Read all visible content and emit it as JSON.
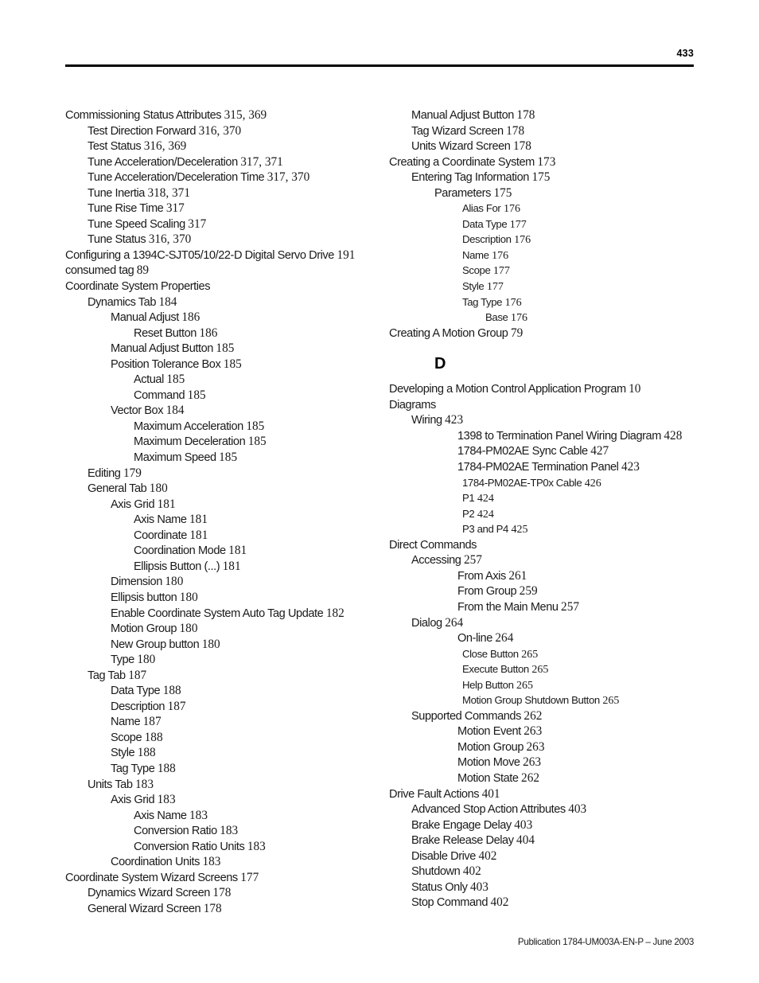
{
  "header": {
    "page_number": "433"
  },
  "footer": {
    "publication": "Publication 1784-UM003A-EN-P – June 2003"
  },
  "columns": {
    "left": [
      {
        "level": 0,
        "text": "Commissioning Status Attributes",
        "pages": "315, 369"
      },
      {
        "level": 1,
        "text": "Test Direction Forward",
        "pages": "316, 370"
      },
      {
        "level": 1,
        "text": "Test Status",
        "pages": "316, 369"
      },
      {
        "level": 1,
        "text": "Tune Acceleration/Deceleration",
        "pages": "317, 371"
      },
      {
        "level": 1,
        "text": "Tune Acceleration/Deceleration Time",
        "pages": "317, 370"
      },
      {
        "level": 1,
        "text": "Tune Inertia",
        "pages": "318, 371"
      },
      {
        "level": 1,
        "text": "Tune Rise Time",
        "pages": "317"
      },
      {
        "level": 1,
        "text": "Tune Speed Scaling",
        "pages": "317"
      },
      {
        "level": 1,
        "text": "Tune Status",
        "pages": "316, 370"
      },
      {
        "level": 0,
        "text": "Configuring a 1394C-SJT05/10/22-D Digital Servo Drive",
        "pages": "191"
      },
      {
        "level": 0,
        "text": "consumed tag",
        "pages": "89"
      },
      {
        "level": 0,
        "text": "Coordinate System Properties",
        "pages": ""
      },
      {
        "level": 1,
        "text": "Dynamics Tab",
        "pages": "184"
      },
      {
        "level": 2,
        "text": "Manual Adjust",
        "pages": "186"
      },
      {
        "level": 3,
        "text": "Reset Button",
        "pages": "186"
      },
      {
        "level": 2,
        "text": "Manual Adjust Button",
        "pages": "185"
      },
      {
        "level": 2,
        "text": "Position Tolerance Box",
        "pages": "185"
      },
      {
        "level": 3,
        "text": "Actual",
        "pages": "185"
      },
      {
        "level": 3,
        "text": "Command",
        "pages": "185"
      },
      {
        "level": 2,
        "text": "Vector Box",
        "pages": "184"
      },
      {
        "level": 3,
        "text": "Maximum Acceleration",
        "pages": "185"
      },
      {
        "level": 3,
        "text": "Maximum Deceleration",
        "pages": "185"
      },
      {
        "level": 3,
        "text": "Maximum Speed",
        "pages": "185"
      },
      {
        "level": 1,
        "text": "Editing",
        "pages": "179"
      },
      {
        "level": 1,
        "text": "General Tab",
        "pages": "180"
      },
      {
        "level": 2,
        "text": "Axis Grid",
        "pages": "181"
      },
      {
        "level": 3,
        "text": "Axis Name",
        "pages": "181"
      },
      {
        "level": 3,
        "text": "Coordinate",
        "pages": "181"
      },
      {
        "level": 3,
        "text": "Coordination Mode",
        "pages": "181"
      },
      {
        "level": 3,
        "text": "Ellipsis Button (...)",
        "pages": "181"
      },
      {
        "level": 2,
        "text": "Dimension",
        "pages": "180"
      },
      {
        "level": 2,
        "text": "Ellipsis button",
        "pages": "180"
      },
      {
        "level": 2,
        "text": "Enable Coordinate System Auto Tag Update",
        "pages": "182"
      },
      {
        "level": 2,
        "text": "Motion Group",
        "pages": "180"
      },
      {
        "level": 2,
        "text": "New Group button",
        "pages": "180"
      },
      {
        "level": 2,
        "text": "Type",
        "pages": "180"
      },
      {
        "level": 1,
        "text": "Tag Tab",
        "pages": "187"
      },
      {
        "level": 2,
        "text": "Data Type",
        "pages": "188"
      },
      {
        "level": 2,
        "text": "Description",
        "pages": "187"
      },
      {
        "level": 2,
        "text": "Name",
        "pages": "187"
      },
      {
        "level": 2,
        "text": "Scope",
        "pages": "188"
      },
      {
        "level": 2,
        "text": "Style",
        "pages": "188"
      },
      {
        "level": 2,
        "text": "Tag Type",
        "pages": "188"
      },
      {
        "level": 1,
        "text": "Units Tab",
        "pages": "183"
      },
      {
        "level": 2,
        "text": "Axis Grid",
        "pages": "183"
      },
      {
        "level": 3,
        "text": "Axis Name",
        "pages": "183"
      },
      {
        "level": 3,
        "text": "Conversion Ratio",
        "pages": "183"
      },
      {
        "level": 3,
        "text": "Conversion Ratio Units",
        "pages": "183"
      },
      {
        "level": 2,
        "text": "Coordination Units",
        "pages": "183"
      },
      {
        "level": 0,
        "text": "Coordinate System Wizard Screens",
        "pages": "177"
      },
      {
        "level": 1,
        "text": "Dynamics Wizard Screen",
        "pages": "178"
      },
      {
        "level": 1,
        "text": "General Wizard Screen",
        "pages": "178"
      }
    ],
    "right_before_section": [
      {
        "level": 1,
        "text": "Manual Adjust Button",
        "pages": "178"
      },
      {
        "level": 1,
        "text": "Tag Wizard Screen",
        "pages": "178"
      },
      {
        "level": 1,
        "text": "Units Wizard Screen",
        "pages": "178"
      },
      {
        "level": 0,
        "text": "Creating a Coordinate System",
        "pages": "173"
      },
      {
        "level": 1,
        "text": "Entering Tag Information",
        "pages": "175"
      },
      {
        "level": 2,
        "text": "Parameters",
        "pages": "175"
      },
      {
        "level": 4,
        "text": "Alias For",
        "pages": "176"
      },
      {
        "level": 4,
        "text": "Data Type",
        "pages": "177"
      },
      {
        "level": 4,
        "text": "Description",
        "pages": "176"
      },
      {
        "level": 4,
        "text": "Name",
        "pages": "176"
      },
      {
        "level": 4,
        "text": "Scope",
        "pages": "177"
      },
      {
        "level": 4,
        "text": "Style",
        "pages": "177"
      },
      {
        "level": 4,
        "text": "Tag Type",
        "pages": "176"
      },
      {
        "level": 5,
        "text": "Base",
        "pages": "176"
      },
      {
        "level": 0,
        "text": "Creating A Motion Group",
        "pages": "79"
      }
    ],
    "section_letter": "D",
    "right_after_section": [
      {
        "level": 0,
        "text": "Developing a Motion Control Application Program",
        "pages": "10"
      },
      {
        "level": 0,
        "text": "Diagrams",
        "pages": ""
      },
      {
        "level": 1,
        "text": "Wiring",
        "pages": "423"
      },
      {
        "level": 3,
        "text": "1398 to Termination Panel Wiring Diagram",
        "pages": "428"
      },
      {
        "level": 3,
        "text": "1784-PM02AE Sync Cable",
        "pages": "427"
      },
      {
        "level": 3,
        "text": "1784-PM02AE Termination Panel",
        "pages": "423"
      },
      {
        "level": 4,
        "text": "1784-PM02AE-TP0x Cable",
        "pages": "426"
      },
      {
        "level": 4,
        "text": "P1",
        "pages": "424"
      },
      {
        "level": 4,
        "text": "P2",
        "pages": "424"
      },
      {
        "level": 4,
        "text": "P3 and P4",
        "pages": "425"
      },
      {
        "level": 0,
        "text": "Direct Commands",
        "pages": ""
      },
      {
        "level": 1,
        "text": "Accessing",
        "pages": "257"
      },
      {
        "level": 3,
        "text": "From Axis",
        "pages": "261"
      },
      {
        "level": 3,
        "text": "From Group",
        "pages": "259"
      },
      {
        "level": 3,
        "text": "From the Main Menu",
        "pages": "257"
      },
      {
        "level": 1,
        "text": "Dialog",
        "pages": "264"
      },
      {
        "level": 3,
        "text": "On-line",
        "pages": "264"
      },
      {
        "level": 4,
        "text": "Close Button",
        "pages": "265"
      },
      {
        "level": 4,
        "text": "Execute Button",
        "pages": "265"
      },
      {
        "level": 4,
        "text": "Help Button",
        "pages": "265"
      },
      {
        "level": 4,
        "text": "Motion Group Shutdown Button",
        "pages": "265"
      },
      {
        "level": 1,
        "text": "Supported Commands",
        "pages": "262"
      },
      {
        "level": 3,
        "text": "Motion Event",
        "pages": "263"
      },
      {
        "level": 3,
        "text": "Motion Group",
        "pages": "263"
      },
      {
        "level": 3,
        "text": "Motion Move",
        "pages": "263"
      },
      {
        "level": 3,
        "text": "Motion State",
        "pages": "262"
      },
      {
        "level": 0,
        "text": "Drive Fault Actions",
        "pages": "401"
      },
      {
        "level": 1,
        "text": "Advanced Stop Action Attributes",
        "pages": "403"
      },
      {
        "level": 1,
        "text": "Brake Engage Delay",
        "pages": "403"
      },
      {
        "level": 1,
        "text": "Brake Release Delay",
        "pages": "404"
      },
      {
        "level": 1,
        "text": "Disable Drive",
        "pages": "402"
      },
      {
        "level": 1,
        "text": "Shutdown",
        "pages": "402"
      },
      {
        "level": 1,
        "text": "Status Only",
        "pages": "403"
      },
      {
        "level": 1,
        "text": "Stop Command",
        "pages": "402"
      }
    ]
  }
}
